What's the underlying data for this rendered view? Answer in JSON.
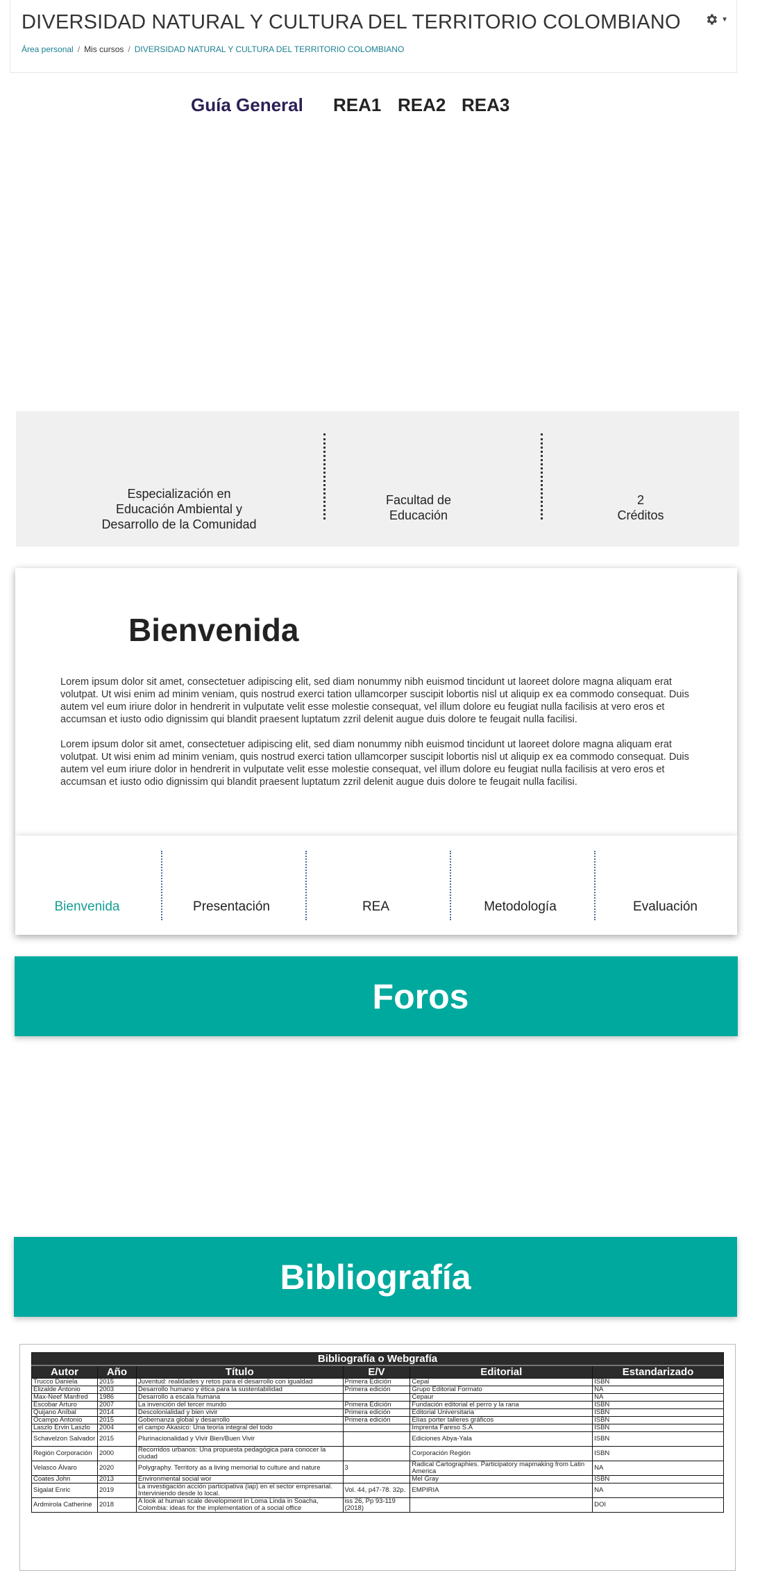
{
  "header": {
    "course_title": "DIVERSIDAD NATURAL Y CULTURA DEL TERRITORIO COLOMBIANO",
    "breadcrumb": [
      "Área personal",
      "Mis cursos",
      "DIVERSIDAD NATURAL Y CULTURA DEL TERRITORIO COLOMBIANO"
    ]
  },
  "tabs": [
    "Guía General",
    "REA1",
    "REA2",
    "REA3"
  ],
  "info": {
    "program": [
      "Especialización en",
      "Educación  Ambiental y",
      "Desarrollo de la  Comunidad"
    ],
    "faculty": [
      "Facultad de",
      "Educación"
    ],
    "credits": [
      "2",
      "Créditos"
    ]
  },
  "welcome": {
    "title": "Bienvenida",
    "paragraphs": [
      "Lorem ipsum dolor sit amet, consectetuer adipiscing elit, sed diam nonummy nibh euismod tincidunt ut laoreet dolore magna aliquam erat volutpat. Ut wisi enim ad minim veniam, quis nostrud exerci tation ullamcorper suscipit lobortis nisl ut aliquip ex ea commodo consequat. Duis autem vel eum iriure dolor in hendrerit in vulputate velit esse molestie consequat, vel illum dolore eu feugiat nulla facilisis at vero eros et accumsan et iusto odio dignissim qui blandit praesent luptatum zzril delenit augue duis dolore te feugait nulla facilisi.",
      "Lorem ipsum dolor sit amet, consectetuer adipiscing elit, sed diam nonummy nibh euismod tincidunt ut laoreet dolore magna aliquam erat volutpat. Ut wisi enim ad minim veniam, quis nostrud exerci tation ullamcorper suscipit lobortis nisl ut aliquip ex ea commodo consequat. Duis autem vel eum iriure dolor in hendrerit in vulputate velit esse molestie consequat, vel illum dolore eu feugiat nulla facilisis at vero eros et accumsan et iusto odio dignissim qui blandit praesent luptatum zzril delenit augue duis dolore te feugait nulla facilisi."
    ]
  },
  "section_nav": {
    "items": [
      "Bienvenida",
      "Presentación",
      "REA",
      "Metodología",
      "Evaluación"
    ],
    "active": "Bienvenida"
  },
  "banners": {
    "forums": "Foros",
    "bibliography": "Bibliografía"
  },
  "bibliography": {
    "caption": "Bibliografía o Webgrafía",
    "columns": [
      "Autor",
      "Año",
      "Título",
      "E/V",
      "Editorial",
      "Estandarizado"
    ],
    "rows": [
      [
        "Trucco Daniela",
        "2015",
        "Juventud: realidades y retos para el desarrollo con igualdad",
        "Primera Edición",
        "Cepal",
        "ISBN"
      ],
      [
        "Elizalde Antonio",
        "2003",
        "Desarrollo humano y ética para la sustentabilidad",
        "Primera edición",
        "Grupo Editorial Formato",
        "NA"
      ],
      [
        "Max-Neef Manfred",
        "1986",
        "Desarrollo a escala humana",
        "",
        "Cepaur",
        "NA"
      ],
      [
        "Escobar Arturo",
        "2007",
        "La invención del tercer mundo",
        "Primera Edición",
        "Fundación editorial el perro y la rana",
        "ISBN"
      ],
      [
        "Quijano Aníbal",
        "2014",
        "Descolonialidad y bien vivir",
        "Primera edición",
        "Editorial Universitaria",
        "ISBN"
      ],
      [
        "Ocampo Antonio",
        "2015",
        "Gobernanza global y desarrollo",
        "Primera edición",
        "Elías porter talleres gráficos",
        "ISBN"
      ],
      [
        "Laszlo Ervin Laszlo",
        "2004",
        "el campo Akasico: Una teoría integral del todo",
        "",
        "Imprenta Fareso S.A",
        "ISBN"
      ],
      [
        "Schavelzon Salvador",
        "2015",
        "Plurinacionalidad y Vivir Bien/Buen Vivir",
        "",
        "Ediciones Abya-Yala",
        "ISBN"
      ],
      [
        "Región Corporación",
        "2000",
        "Recorridos urbanos: Una propuesta pedagógica para conocer la ciudad",
        "",
        "Corporación Región",
        "ISBN"
      ],
      [
        "Velasco Álvaro",
        "2020",
        "Polygraphy. Territory as a living memorial to culture and nature",
        "3",
        "Radical Cartographies. Participatory mapmaking from Latin America",
        "NA"
      ],
      [
        "Coates John",
        "2013",
        "Environmental social wor",
        "",
        "Mel Gray",
        "ISBN"
      ],
      [
        "Sigalat Enric",
        "2019",
        "La investigación acción participativa (iap) en el sector empresarial. Interviniendo desde lo local.",
        "Vol. 44, p47-78. 32p.",
        "EMPIRIA",
        "NA"
      ],
      [
        "Ardmirola Catherine",
        "2018",
        "A look at human scale development in Loma Linda in Soacha, Colombia: ideas for the implementation of a social office",
        "iss 26, Pp 93-119 (2018)",
        "",
        "DOI"
      ]
    ]
  }
}
